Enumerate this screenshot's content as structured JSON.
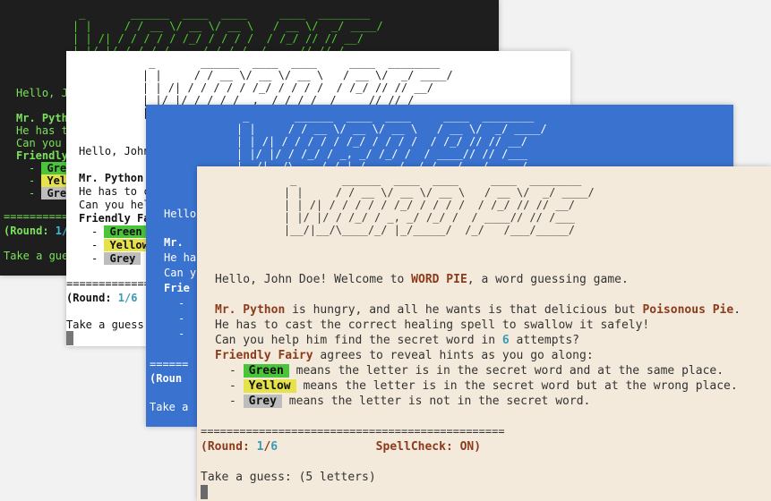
{
  "banner_art": "     _       ______  ____  ____     ____  ________\n    | |     / / __ \\/ __ \\/ __ \\   / __ \\/  _/ ____/\n    | | /| / / / / / /_/ / / / /  / /_/ // // __/\n    | |/ |/ / /_/ / _, _/ /_/ /  / ____// // /___\n    |__/|__/\\____/_/ |_/_____/  /_/   /___/_____/",
  "game": {
    "greeting_prefix": "Hello, ",
    "user": "John Doe",
    "greeting_mid": "! Welcome to ",
    "game_name": "WORD PIE",
    "greeting_suffix": ", a word guessing game.",
    "character": "Mr. Python",
    "hungry_text": " is hungry, and all he wants is that delicious but ",
    "pie": "Poisonous Pie",
    "dot": ".",
    "spell_line": "He has to cast the correct healing spell to swallow it safely!",
    "help_prefix": "Can you help him find the secret word in ",
    "attempts": "6",
    "help_suffix": " attempts?",
    "fairy": "Friendly Fairy",
    "fairy_suffix": " agrees to reveal hints as you go along:",
    "hints": [
      {
        "label": "Green",
        "text": " means the letter is in the secret word and at the same place."
      },
      {
        "label": "Yellow",
        "text": " means the letter is in the secret word but at the wrong place."
      },
      {
        "label": "Grey",
        "text": " means the letter is not in the secret word."
      }
    ],
    "separator": "===============================================",
    "round_prefix": "(Round: ",
    "round_current": "1",
    "round_slash": "/",
    "round_total": "6",
    "spell_check": "              SpellCheck: ON)",
    "prompt": "Take a guess: (5 letters)",
    "short_greeting_1": "Hello, J",
    "short_greeting_2": "Hello, John",
    "short_greeting_3": "Hello",
    "short_char_1": "Mr. Pyth",
    "short_char_2": "Mr. Python",
    "short_char_3": "Mr.",
    "short_spell_1": "He has t",
    "short_spell_2": "He has to c",
    "short_spell_3": "He ha",
    "short_help_1": "Can you",
    "short_help_2": "Can you hel",
    "short_help_3": "Can y",
    "short_fairy_1": "Friendly",
    "short_fairy_2": "Friendly Fa",
    "short_fairy_3": "Frie",
    "short_hint_g": "Gre",
    "short_hint_y": "Yel",
    "short_round_1": "(Round: ",
    "short_round_num": "1/",
    "short_round_2": "(Round: ",
    "short_round_num2": "1/6",
    "short_round_3": "(Roun",
    "short_prompt_1": "Take a gue",
    "short_prompt_2": "Take a guess:",
    "short_prompt_3": "Take a",
    "short_sep_1": "==========",
    "short_sep_2": "=========================",
    "short_sep_3": "======"
  },
  "colors": {
    "green": "#4ac43a",
    "yellow": "#e6e24a",
    "grey": "#bdbdbd",
    "accent": "#8b3b1c",
    "number": "#3a9bb5"
  }
}
